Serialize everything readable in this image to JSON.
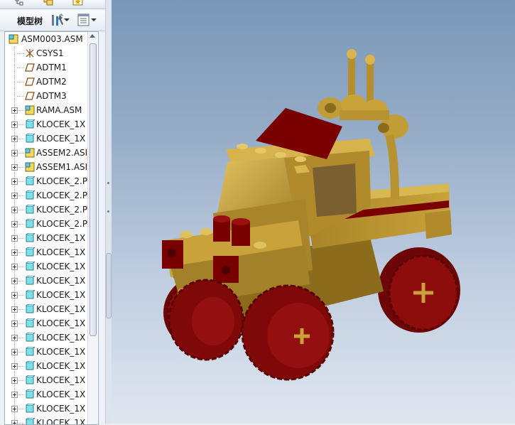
{
  "model_tree": {
    "label": "模型树",
    "tools_icon": "model-tree-settings-icon",
    "view_icon": "tree-view-options-icon",
    "items": [
      {
        "label": "ASM0003.ASM",
        "icon": "assembly-icon",
        "expandable": false
      },
      {
        "label": "CSYS1",
        "icon": "coordinate-system-icon",
        "expandable": false
      },
      {
        "label": "ADTM1",
        "icon": "datum-plane-icon",
        "expandable": false
      },
      {
        "label": "ADTM2",
        "icon": "datum-plane-icon",
        "expandable": false
      },
      {
        "label": "ADTM3",
        "icon": "datum-plane-icon",
        "expandable": false
      },
      {
        "label": "RAMA.ASM",
        "icon": "assembly-icon",
        "expandable": true
      },
      {
        "label": "KLOCEK_1X",
        "icon": "part-icon",
        "expandable": true
      },
      {
        "label": "KLOCEK_1X",
        "icon": "part-icon",
        "expandable": true
      },
      {
        "label": "ASSEM2.ASI",
        "icon": "assembly-icon",
        "expandable": true
      },
      {
        "label": "ASSEM1.ASI",
        "icon": "assembly-icon",
        "expandable": true
      },
      {
        "label": "KLOCEK_2.P",
        "icon": "part-icon",
        "expandable": true
      },
      {
        "label": "KLOCEK_2.P",
        "icon": "part-icon",
        "expandable": true
      },
      {
        "label": "KLOCEK_2.P",
        "icon": "part-icon",
        "expandable": true
      },
      {
        "label": "KLOCEK_2.P",
        "icon": "part-icon",
        "expandable": true
      },
      {
        "label": "KLOCEK_1X",
        "icon": "part-icon",
        "expandable": true
      },
      {
        "label": "KLOCEK_1X",
        "icon": "part-icon",
        "expandable": true
      },
      {
        "label": "KLOCEK_1X",
        "icon": "part-icon",
        "expandable": true
      },
      {
        "label": "KLOCEK_1X",
        "icon": "part-icon",
        "expandable": true
      },
      {
        "label": "KLOCEK_1X",
        "icon": "part-icon",
        "expandable": true
      },
      {
        "label": "KLOCEK_1X",
        "icon": "part-icon",
        "expandable": true
      },
      {
        "label": "KLOCEK_1X",
        "icon": "part-icon",
        "expandable": true
      },
      {
        "label": "KLOCEK_1X",
        "icon": "part-icon",
        "expandable": true
      },
      {
        "label": "KLOCEK_1X",
        "icon": "part-icon",
        "expandable": true
      },
      {
        "label": "KLOCEK_1X",
        "icon": "part-icon",
        "expandable": true
      },
      {
        "label": "KLOCEK_1X",
        "icon": "part-icon",
        "expandable": true
      },
      {
        "label": "KLOCEK_1X",
        "icon": "part-icon",
        "expandable": true
      },
      {
        "label": "KLOCEK_1X",
        "icon": "part-icon",
        "expandable": true
      },
      {
        "label": "KLOCEK_1X",
        "icon": "part-icon",
        "expandable": true
      }
    ]
  },
  "viewport": {
    "model_icon": "lego-truck-model",
    "colors": {
      "body": "#c9a23a",
      "body_dark": "#8a6c1c",
      "accent": "#7a0000",
      "tire": "#8b0a0a"
    }
  }
}
